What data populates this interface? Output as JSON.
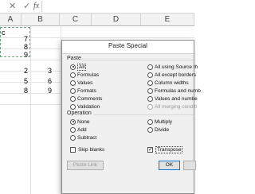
{
  "formula_bar": {
    "cancel_icon": "x-icon",
    "cancel_glyph": "✕",
    "enter_icon": "check-icon",
    "enter_glyph": "✓",
    "function_label": "fx"
  },
  "spreadsheet": {
    "column_headers": [
      "A",
      "B",
      "C",
      "D",
      "E"
    ],
    "cells": {
      "a1_partial": "c",
      "column_a_values": [
        "7",
        "8",
        "9"
      ],
      "block_col1": [
        "2",
        "5",
        "8"
      ],
      "block_col2": [
        "3",
        "6",
        "9"
      ]
    }
  },
  "dialog": {
    "title": "Paste Special",
    "paste_section": {
      "label": "Paste",
      "left_options": [
        {
          "label": "All",
          "checked": true
        },
        {
          "label": "Formulas",
          "checked": false
        },
        {
          "label": "Values",
          "checked": false
        },
        {
          "label": "Formats",
          "checked": false
        },
        {
          "label": "Comments",
          "checked": false
        },
        {
          "label": "Validation",
          "checked": false
        }
      ],
      "right_options": [
        {
          "label": "All using Source th",
          "checked": false
        },
        {
          "label": "All except borders",
          "checked": false
        },
        {
          "label": "Column widths",
          "checked": false
        },
        {
          "label": "Formulas and numb",
          "checked": false
        },
        {
          "label": "Values and numbe",
          "checked": false
        },
        {
          "label": "All merging conditi",
          "checked": false,
          "disabled": true
        }
      ]
    },
    "operation_section": {
      "label": "Operation",
      "left_options": [
        {
          "label": "None",
          "checked": true
        },
        {
          "label": "Add",
          "checked": false
        },
        {
          "label": "Subtract",
          "checked": false
        }
      ],
      "right_options": [
        {
          "label": "Multiply",
          "checked": false
        },
        {
          "label": "Divide",
          "checked": false
        }
      ]
    },
    "skip_blanks": {
      "label": "Skip blanks",
      "checked": false
    },
    "transpose": {
      "label": "Transpose",
      "checked": true,
      "mark": "✓"
    },
    "buttons": {
      "paste_link": "Paste Link",
      "ok": "OK"
    }
  }
}
